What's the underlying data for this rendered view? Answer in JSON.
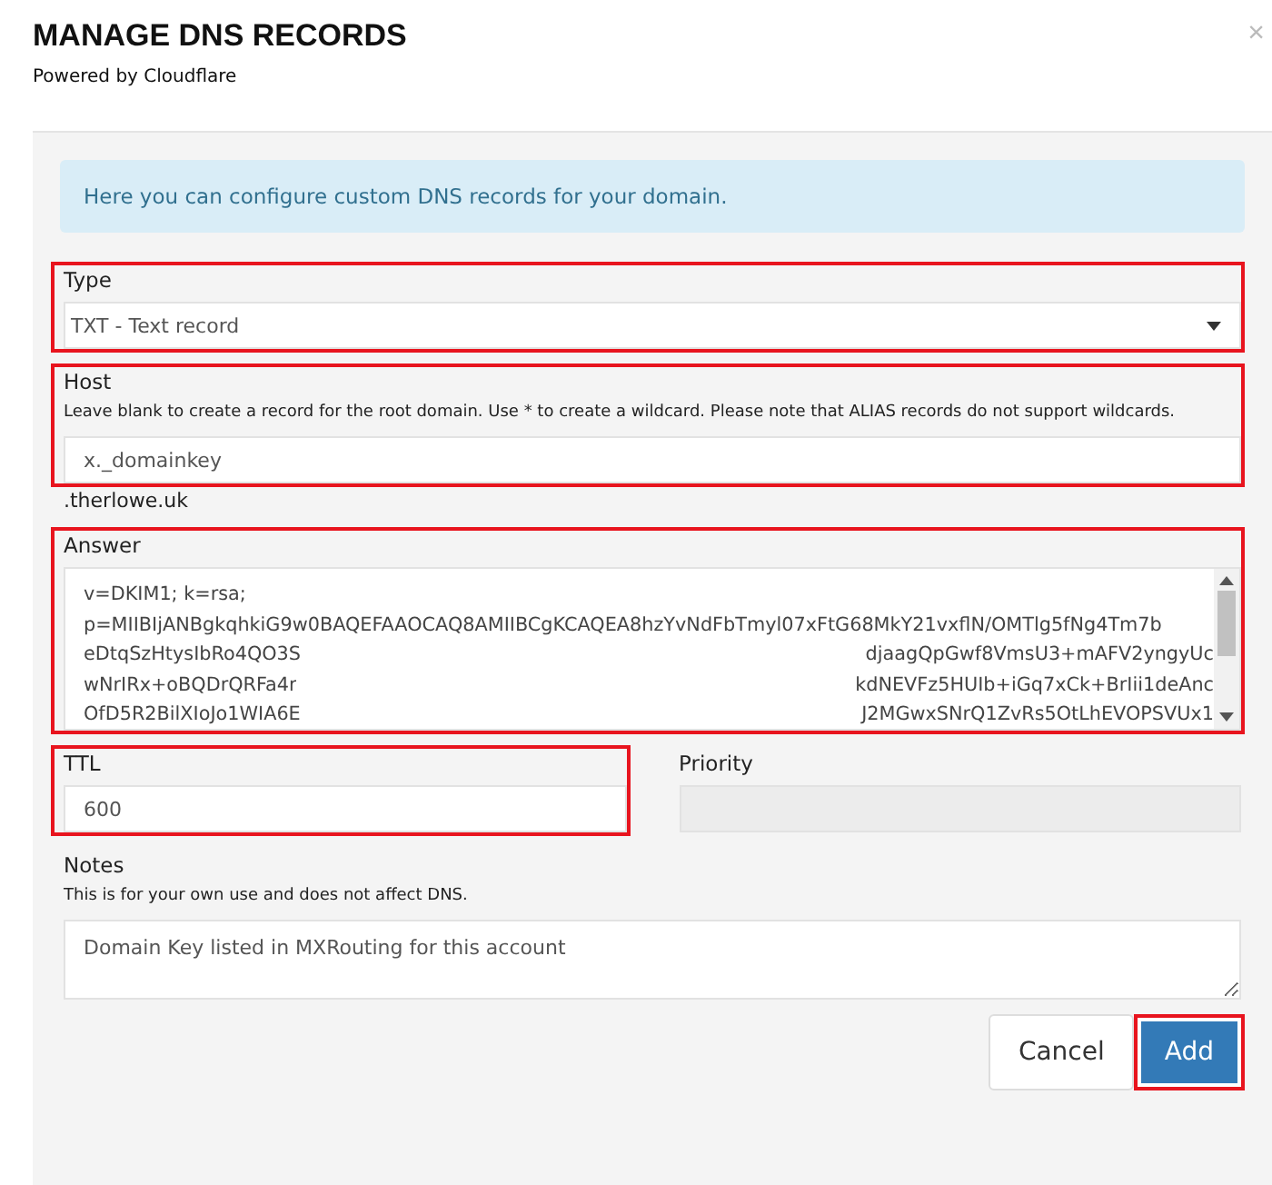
{
  "dialog": {
    "title": "MANAGE DNS RECORDS",
    "subtitle": "Powered by Cloudflare",
    "close": "×"
  },
  "alert": "Here you can configure custom DNS records for your domain.",
  "type_field": {
    "label": "Type",
    "value": "TXT - Text record",
    "highlighted": true
  },
  "host_field": {
    "label": "Host",
    "help": "Leave blank to create a record for the root domain. Use * to create a wildcard. Please note that ALIAS records do not support wildcards.",
    "value": "x._domainkey",
    "suffix": ".therlowe.uk",
    "highlighted": true
  },
  "answer_field": {
    "label": "Answer",
    "highlighted": true,
    "lines": [
      {
        "kind": "full",
        "text": "v=DKIM1; k=rsa;"
      },
      {
        "kind": "full",
        "text": "p=MIIBIjANBgkqhkiG9w0BAQEFAAOCAQ8AMIIBCgKCAQEA8hzYvNdFbTmyl07xFtG68MkY21vxflN/OMTlg5fNg4Tm7b"
      },
      {
        "kind": "redacted",
        "left": "eDtqSzHtysIbRo4QO3S",
        "right": "djaagQpGwf8VmsU3+mAFV2yngyUc"
      },
      {
        "kind": "redacted",
        "left": "wNrIRx+oBQDrQRFa4r",
        "right": "kdNEVFz5HUIb+iGq7xCk+BrIii1deAnc"
      },
      {
        "kind": "redacted",
        "left": "OfD5R2BilXIoJo1WIA6E",
        "right": "J2MGwxSNrQ1ZvRs5OtLhEVOPSVUx1"
      }
    ]
  },
  "ttl_field": {
    "label": "TTL",
    "value": "600",
    "highlighted": true
  },
  "priority_field": {
    "label": "Priority",
    "disabled": true
  },
  "notes_field": {
    "label": "Notes",
    "help": "This is for your own use and does not affect DNS.",
    "value": "Domain Key listed in MXRouting for this account"
  },
  "buttons": [
    {
      "label": "Cancel",
      "kind": "default",
      "highlighted": false
    },
    {
      "label": "Add",
      "kind": "primary",
      "highlighted": true
    }
  ]
}
